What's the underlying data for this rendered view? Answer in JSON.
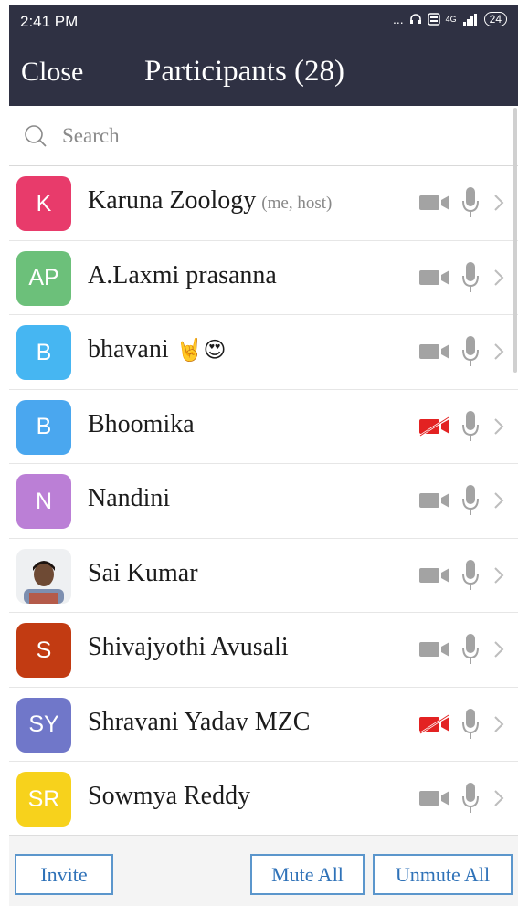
{
  "status": {
    "time": "2:41 PM",
    "dots": "...",
    "network": "4G",
    "battery": "24"
  },
  "header": {
    "close_label": "Close",
    "title": "Participants (28)"
  },
  "search": {
    "placeholder": "Search"
  },
  "participants": [
    {
      "initials": "K",
      "name": "Karuna Zoology",
      "role": "(me, host)",
      "emoji": "",
      "avatar_color": "#e83b6b",
      "video_off": false,
      "photo": false
    },
    {
      "initials": "AP",
      "name": "A.Laxmi prasanna",
      "role": "",
      "emoji": "",
      "avatar_color": "#6cc07a",
      "video_off": false,
      "photo": false
    },
    {
      "initials": "B",
      "name": "bhavani",
      "role": "",
      "emoji": "🤘😍",
      "avatar_color": "#46b6f2",
      "video_off": false,
      "photo": false
    },
    {
      "initials": "B",
      "name": "Bhoomika",
      "role": "",
      "emoji": "",
      "avatar_color": "#4aa7ef",
      "video_off": true,
      "photo": false
    },
    {
      "initials": "N",
      "name": "Nandini",
      "role": "",
      "emoji": "",
      "avatar_color": "#bb7fd6",
      "video_off": false,
      "photo": false
    },
    {
      "initials": "",
      "name": "Sai Kumar",
      "role": "",
      "emoji": "",
      "avatar_color": "#8aa0b8",
      "video_off": false,
      "photo": true
    },
    {
      "initials": "S",
      "name": "Shivajyothi Avusali",
      "role": "",
      "emoji": "",
      "avatar_color": "#c23b12",
      "video_off": false,
      "photo": false
    },
    {
      "initials": "SY",
      "name": "Shravani Yadav MZC",
      "role": "",
      "emoji": "",
      "avatar_color": "#7077c9",
      "video_off": true,
      "photo": false
    },
    {
      "initials": "SR",
      "name": "Sowmya Reddy",
      "role": "",
      "emoji": "",
      "avatar_color": "#f7d21c",
      "video_off": false,
      "photo": false
    }
  ],
  "footer": {
    "invite_label": "Invite",
    "mute_all_label": "Mute All",
    "unmute_all_label": "Unmute All"
  },
  "colors": {
    "header_bg": "#2f3143",
    "video_off": "#e32222",
    "icon_gray": "#a3a3a3",
    "button_border": "#5b96cc"
  }
}
